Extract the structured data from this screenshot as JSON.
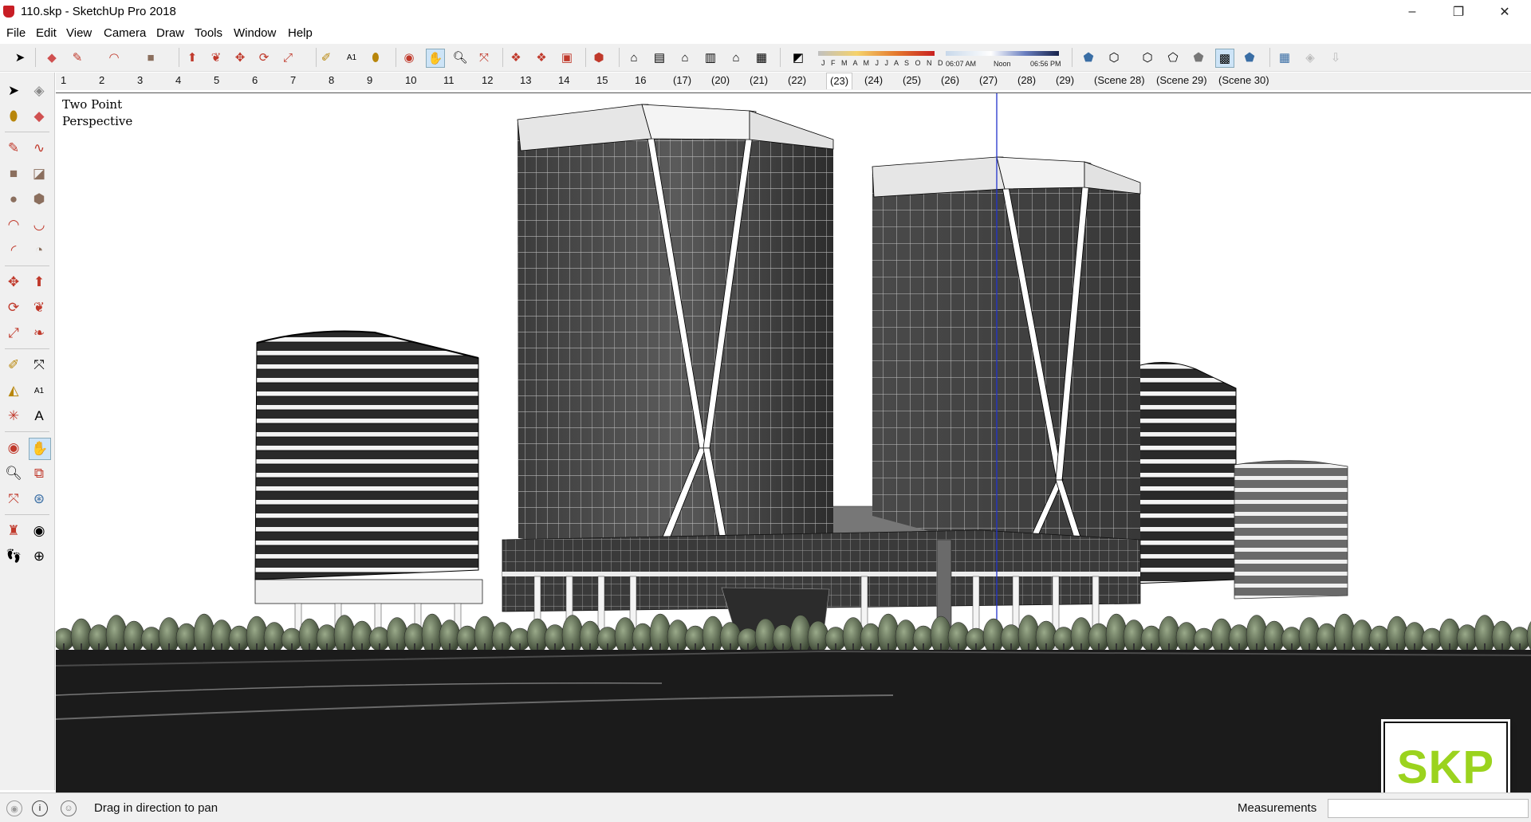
{
  "window": {
    "title": "110.skp - SketchUp Pro 2018",
    "controls": {
      "minimize": "–",
      "restore": "❐",
      "close": "✕"
    }
  },
  "menu": [
    "File",
    "Edit",
    "View",
    "Camera",
    "Draw",
    "Tools",
    "Window",
    "Help"
  ],
  "toolbar": {
    "shadow_months": "J F M A M J J A S O N D",
    "shadow_time_start": "06:07 AM",
    "shadow_time_mid": "Noon",
    "shadow_time_end": "06:56 PM"
  },
  "scenes": {
    "tabs": [
      "1",
      "2",
      "3",
      "4",
      "5",
      "6",
      "7",
      "8",
      "9",
      "10",
      "11",
      "12",
      "13",
      "14",
      "15",
      "16",
      "(17)",
      "(20)",
      "(21)",
      "(22)",
      "(23)",
      "(24)",
      "(25)",
      "(26)",
      "(27)",
      "(28)",
      "(29)",
      "(Scene 28)",
      "(Scene 29)",
      "(Scene 30)"
    ],
    "active": "(23)"
  },
  "viewport": {
    "camera_label": "Two Point\nPerspective"
  },
  "status": {
    "message": "Drag in direction to pan",
    "measurements_label": "Measurements",
    "measurements_value": ""
  },
  "watermark": {
    "text": "SKP",
    "color": "#9bd31e"
  },
  "colors": {
    "brand_red": "#c81e25",
    "axis_blue": "#2233cc"
  }
}
